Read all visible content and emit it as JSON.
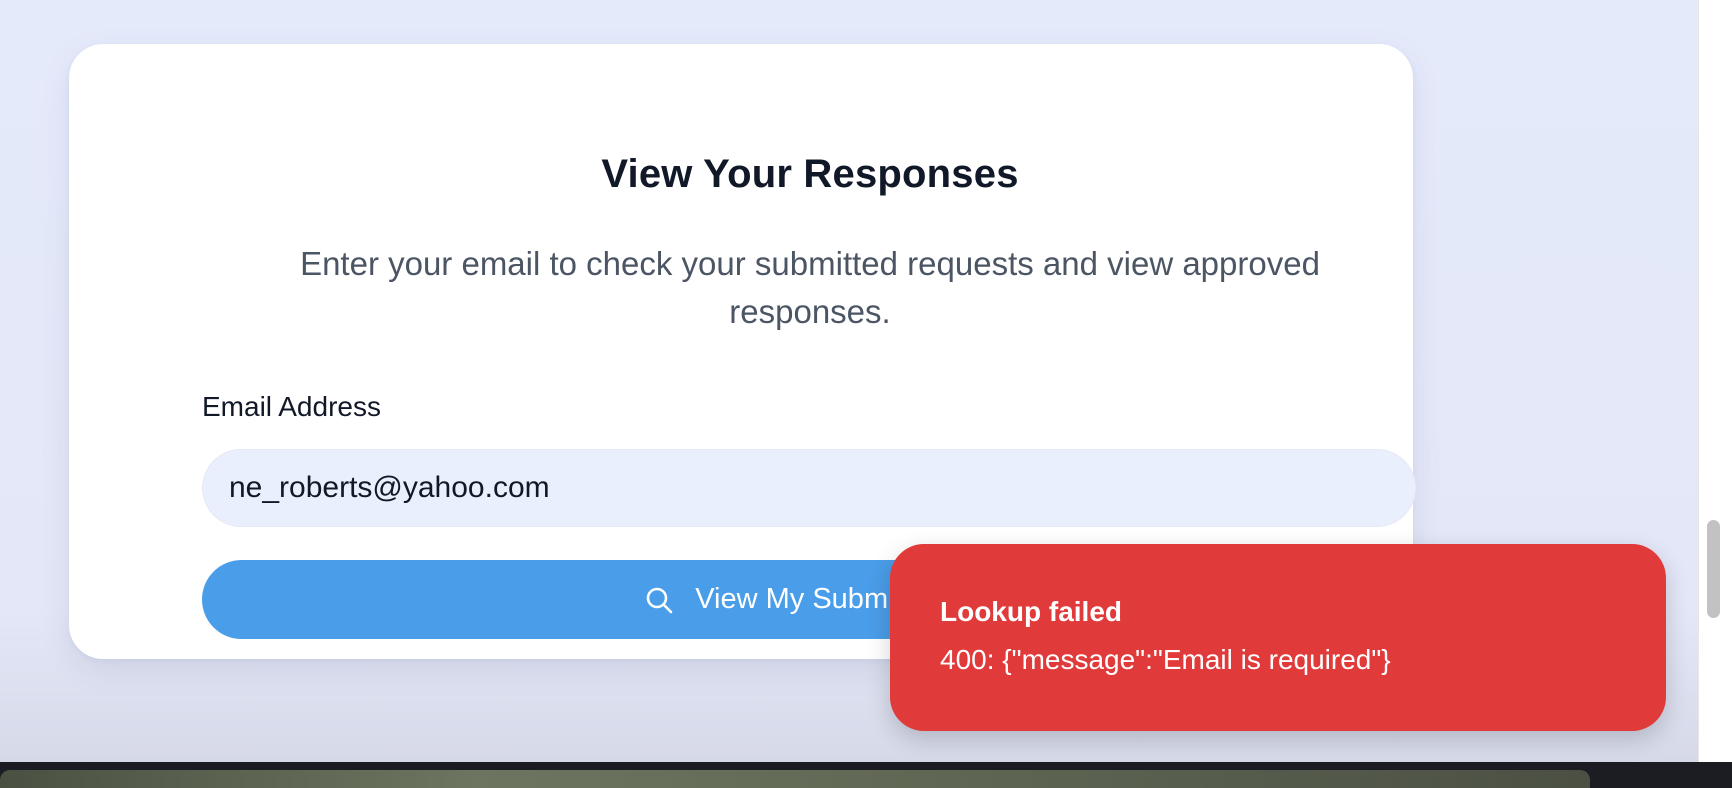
{
  "card": {
    "title": "View Your Responses",
    "subtitle": "Enter your email to check your submitted requests and view approved responses.",
    "email_label": "Email Address",
    "email_value": "ne_roberts@yahoo.com",
    "submit_label": "View My Submissions",
    "submit_icon": "search-icon"
  },
  "toast": {
    "title": "Lookup failed",
    "message": "400: {\"message\":\"Email is required\"}",
    "color": "#e03a3a"
  },
  "colors": {
    "accent": "#4a9de8",
    "page_background": "#e5eafb",
    "error": "#e03a3a"
  }
}
